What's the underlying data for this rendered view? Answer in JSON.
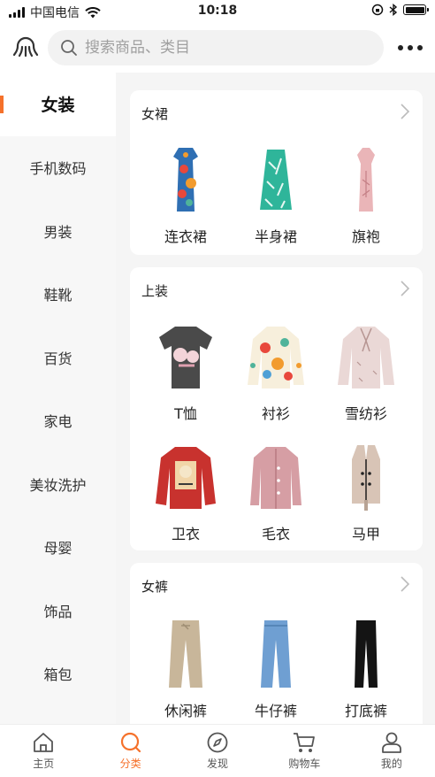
{
  "status_bar": {
    "carrier": "中国电信",
    "time": "10:18"
  },
  "header": {
    "search_placeholder": "搜索商品、类目",
    "logo_icon": "octopus-logo-icon",
    "more_icon": "more-dots-icon"
  },
  "sidebar": {
    "items": [
      {
        "label": "女装",
        "active": true
      },
      {
        "label": "手机数码"
      },
      {
        "label": "男装"
      },
      {
        "label": "鞋靴"
      },
      {
        "label": "百货"
      },
      {
        "label": "家电"
      },
      {
        "label": "美妆洗护"
      },
      {
        "label": "母婴"
      },
      {
        "label": "饰品"
      },
      {
        "label": "箱包"
      }
    ]
  },
  "sections": [
    {
      "title": "女裙",
      "items": [
        {
          "label": "连衣裙",
          "icon": "floral-dress-icon"
        },
        {
          "label": "半身裙",
          "icon": "midi-skirt-icon"
        },
        {
          "label": "旗袍",
          "icon": "qipao-icon"
        }
      ]
    },
    {
      "title": "上装",
      "items": [
        {
          "label": "T恤",
          "icon": "tshirt-icon"
        },
        {
          "label": "衬衫",
          "icon": "shirt-icon"
        },
        {
          "label": "雪纺衫",
          "icon": "chiffon-blouse-icon"
        },
        {
          "label": "卫衣",
          "icon": "sweatshirt-icon"
        },
        {
          "label": "毛衣",
          "icon": "cardigan-icon"
        },
        {
          "label": "马甲",
          "icon": "vest-icon"
        }
      ]
    },
    {
      "title": "女裤",
      "items": [
        {
          "label": "休闲裤",
          "icon": "casual-pants-icon"
        },
        {
          "label": "牛仔裤",
          "icon": "jeans-icon"
        },
        {
          "label": "打底裤",
          "icon": "leggings-icon"
        }
      ]
    }
  ],
  "tabbar": {
    "items": [
      {
        "label": "主页",
        "icon": "home-icon"
      },
      {
        "label": "分类",
        "icon": "category-search-icon",
        "active": true
      },
      {
        "label": "发现",
        "icon": "compass-icon"
      },
      {
        "label": "购物车",
        "icon": "cart-icon"
      },
      {
        "label": "我的",
        "icon": "profile-icon"
      }
    ]
  },
  "colors": {
    "accent": "#f5712b",
    "sidebar_bg": "#f7f7f7",
    "page_bg": "#f5f5f5"
  }
}
